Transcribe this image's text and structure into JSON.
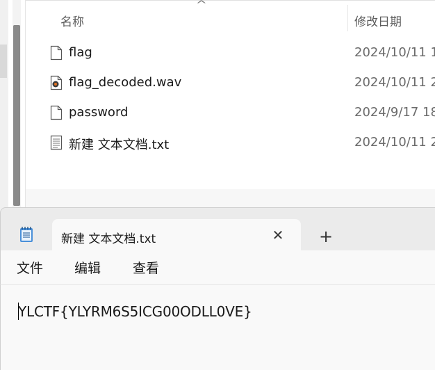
{
  "explorer": {
    "columns": {
      "name": "名称",
      "date_modified": "修改日期"
    },
    "files": [
      {
        "name": "flag",
        "date": "2024/10/11 1",
        "icon": "blank-file-icon"
      },
      {
        "name": "flag_decoded.wav",
        "date": "2024/10/11 2",
        "icon": "audio-file-icon"
      },
      {
        "name": "password",
        "date": "2024/9/17 18",
        "icon": "blank-file-icon"
      },
      {
        "name": "新建 文本文档.txt",
        "date": "2024/10/11 2",
        "icon": "text-file-icon"
      }
    ]
  },
  "notepad": {
    "tab_title": "新建 文本文档.txt",
    "close_glyph": "✕",
    "new_tab_glyph": "+",
    "menu": {
      "file": "文件",
      "edit": "编辑",
      "view": "查看"
    },
    "content": "YLCTF{YLYRM6S5ICG00ODLL0VE}"
  },
  "colors": {
    "accent": "#1a73c8",
    "text": "#1a1a1a",
    "muted": "#6b6b6b"
  }
}
